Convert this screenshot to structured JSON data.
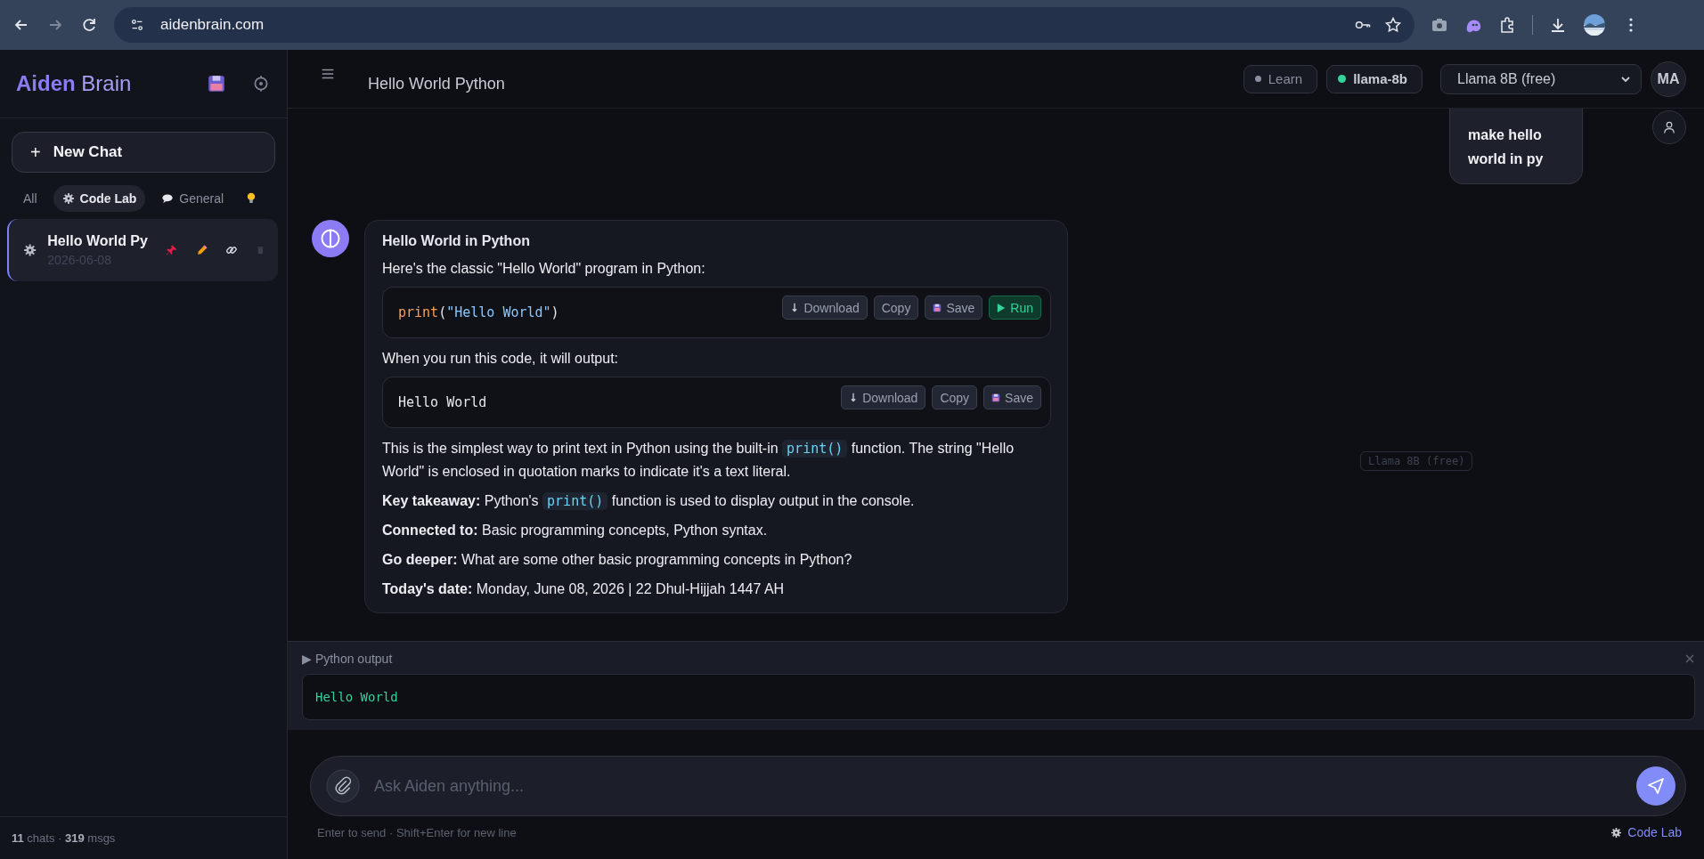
{
  "browser": {
    "url": "aidenbrain.com",
    "forward_disabled": true
  },
  "sidebar": {
    "logo_strong": "Aiden",
    "logo_light": "Brain",
    "new_chat": {
      "icon": "+",
      "label": "New Chat"
    },
    "filters": [
      {
        "kind": "text",
        "label": "All",
        "selected": false
      },
      {
        "kind": "gear",
        "label": "Code Lab",
        "selected": true
      },
      {
        "kind": "speech",
        "label": "General",
        "selected": false
      },
      {
        "kind": "bulb",
        "selected": false
      }
    ],
    "chats": [
      {
        "title": "Hello World Py",
        "date": "2026-06-08",
        "selected": true
      }
    ],
    "footer": "**11** chats · **319** msgs"
  },
  "header": {
    "title": "Hello World Python",
    "learn": {
      "label": "Learn",
      "on": false
    },
    "model_badge": {
      "label": "llama-8b",
      "color": "#34d399"
    },
    "model_select": "Llama 8B (free)",
    "avatar": "MA"
  },
  "messages": [
    {
      "kind": "user",
      "text": "make hello world in py"
    },
    {
      "kind": "assistant",
      "blocks": [
        {
          "kind": "heading",
          "text": "Hello World in Python"
        },
        {
          "kind": "paragraph",
          "segments": [
            {
              "kind": "text",
              "text": "Here's the classic \"Hello World\" program in Python:"
            }
          ]
        },
        {
          "kind": "code",
          "tokens": [
            {
              "kind": "function",
              "text": "print"
            },
            {
              "kind": "punct",
              "text": "("
            },
            {
              "kind": "string",
              "text": "\"Hello World\""
            },
            {
              "kind": "punct",
              "text": ")"
            }
          ],
          "buttons": [
            {
              "kind": "download",
              "label": "Download"
            },
            {
              "kind": "copy",
              "label": "Copy"
            },
            {
              "kind": "save",
              "label": "Save"
            },
            {
              "kind": "run",
              "label": "Run"
            }
          ]
        },
        {
          "kind": "paragraph",
          "segments": [
            {
              "kind": "text",
              "text": "When you run this code, it will output:"
            }
          ]
        },
        {
          "kind": "code",
          "tokens": [
            {
              "kind": "plain",
              "text": "Hello World"
            }
          ],
          "buttons": [
            {
              "kind": "download",
              "label": "Download"
            },
            {
              "kind": "copy",
              "label": "Copy"
            },
            {
              "kind": "save",
              "label": "Save"
            }
          ]
        },
        {
          "kind": "paragraph",
          "segments": [
            {
              "kind": "text",
              "text": "This is the simplest way to print text in Python using the built-in "
            },
            {
              "kind": "code",
              "text": "print()"
            },
            {
              "kind": "text",
              "text": " function. The string \"Hello World\" is enclosed in quotation marks to indicate it's a text literal."
            }
          ]
        },
        {
          "kind": "paragraph",
          "segments": [
            {
              "kind": "text",
              "text": "**Key takeaway:** Python's "
            },
            {
              "kind": "code",
              "text": "print()"
            },
            {
              "kind": "text",
              "text": " function is used to display output in the console."
            }
          ]
        },
        {
          "kind": "paragraph",
          "segments": [
            {
              "kind": "text",
              "text": "**Connected to:** Basic programming concepts, Python syntax."
            }
          ]
        },
        {
          "kind": "paragraph",
          "segments": [
            {
              "kind": "text",
              "text": "**Go deeper:** What are some other basic programming concepts in Python?"
            }
          ]
        },
        {
          "kind": "paragraph",
          "segments": [
            {
              "kind": "text",
              "text": "**Today's date:** Monday, June 08, 2026 | 22 Dhul-Hijjah 1447 AH"
            }
          ]
        }
      ]
    }
  ],
  "model_tag": "Llama 8B (free)",
  "output_panel": {
    "marker": "▶",
    "title": "Python output",
    "output": "Hello World"
  },
  "composer": {
    "placeholder": "Ask Aiden anything...",
    "hint": "Enter to send · Shift+Enter for new line",
    "mode": "Code Lab"
  }
}
